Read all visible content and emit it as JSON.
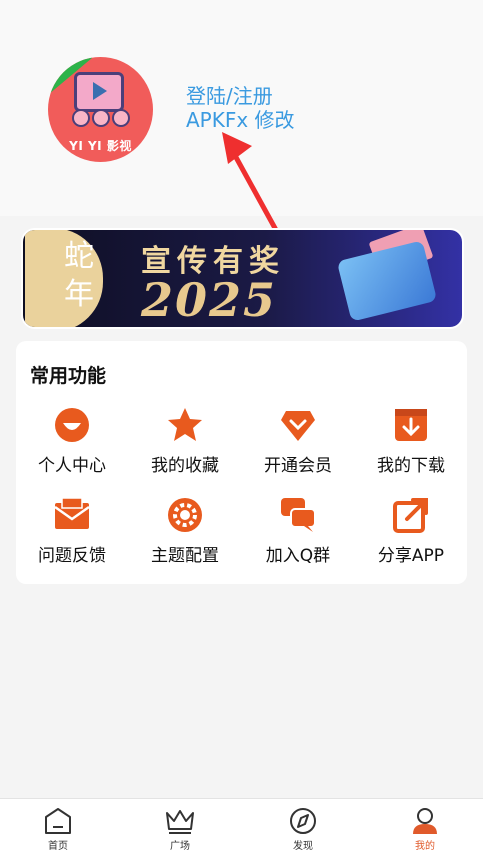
{
  "profile": {
    "avatar_label": "YI YI 影视",
    "login_link": "登陆/注册",
    "username": "APKFx 修改"
  },
  "banner": {
    "seal_text": "蛇年",
    "title": "宣传有奖",
    "year": "2025"
  },
  "functions": {
    "title": "常用功能",
    "items": [
      {
        "label": "个人中心",
        "icon": "smile-icon"
      },
      {
        "label": "我的收藏",
        "icon": "star-icon"
      },
      {
        "label": "开通会员",
        "icon": "diamond-icon"
      },
      {
        "label": "我的下载",
        "icon": "download-icon"
      },
      {
        "label": "问题反馈",
        "icon": "envelope-icon"
      },
      {
        "label": "主题配置",
        "icon": "gear-icon"
      },
      {
        "label": "加入Q群",
        "icon": "chat-icon"
      },
      {
        "label": "分享APP",
        "icon": "share-icon"
      }
    ]
  },
  "tabbar": {
    "items": [
      {
        "label": "首页",
        "icon": "home-icon"
      },
      {
        "label": "广场",
        "icon": "crown-icon"
      },
      {
        "label": "发现",
        "icon": "compass-icon"
      },
      {
        "label": "我的",
        "icon": "user-icon"
      }
    ],
    "active_index": 3
  },
  "colors": {
    "accent": "#e85a1e",
    "link": "#3a9ae0",
    "active_tab": "#e05a2b"
  }
}
